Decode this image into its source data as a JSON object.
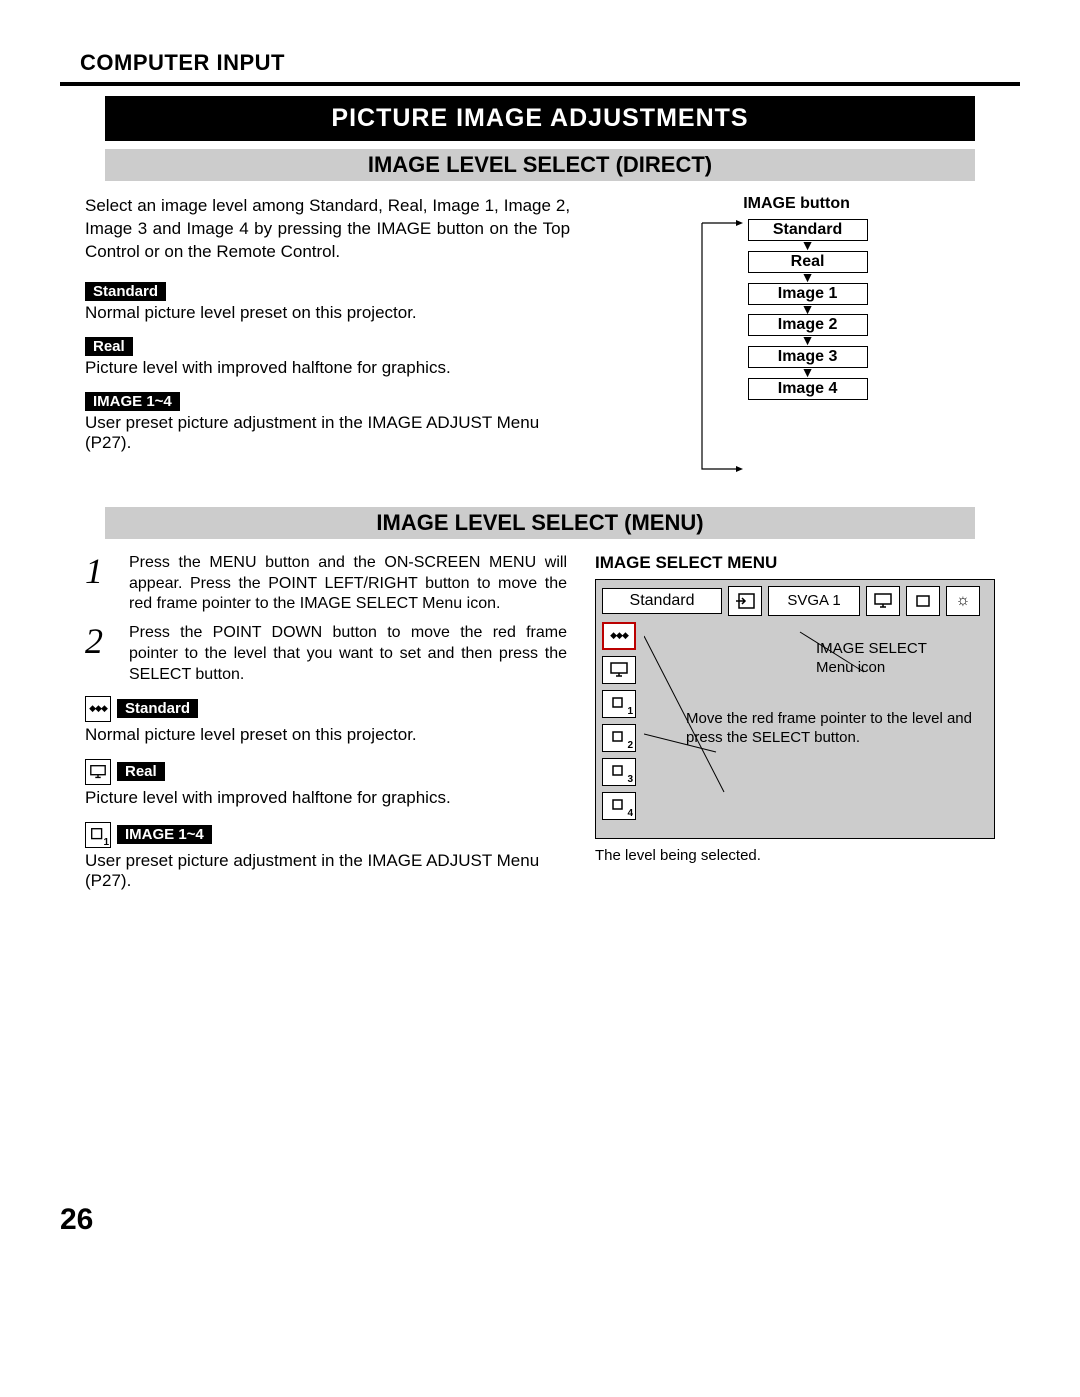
{
  "header": {
    "section_label": "COMPUTER INPUT"
  },
  "bars": {
    "main": "PICTURE IMAGE ADJUSTMENTS",
    "sub_direct": "IMAGE LEVEL SELECT (DIRECT)",
    "sub_menu": "IMAGE LEVEL SELECT (MENU)"
  },
  "direct": {
    "intro": "Select an image level among Standard, Real, Image 1, Image 2, Image 3 and Image 4 by pressing the IMAGE button on the Top Control or on the Remote Control.",
    "items": [
      {
        "label": "Standard",
        "desc": "Normal picture level preset on this projector."
      },
      {
        "label": "Real",
        "desc": "Picture level with improved halftone for graphics."
      },
      {
        "label": "IMAGE 1~4",
        "desc": "User preset picture adjustment in the IMAGE ADJUST Menu (P27)."
      }
    ],
    "flow": {
      "title": "IMAGE button",
      "boxes": [
        "Standard",
        "Real",
        "Image 1",
        "Image 2",
        "Image 3",
        "Image 4"
      ]
    }
  },
  "menu": {
    "steps": [
      {
        "num": "1",
        "text": "Press the MENU button and the ON-SCREEN MENU will appear.  Press the POINT LEFT/RIGHT button to move the red frame pointer to the IMAGE SELECT Menu icon."
      },
      {
        "num": "2",
        "text": "Press the POINT DOWN button to move the red frame pointer to the level that you want to set and then press the SELECT button."
      }
    ],
    "items": [
      {
        "label": "Standard",
        "desc": "Normal picture level preset on this projector.",
        "icon": "diamonds"
      },
      {
        "label": "Real",
        "desc": "Picture level with improved halftone for graphics.",
        "icon": "monitor"
      },
      {
        "label": "IMAGE 1~4",
        "desc": "User preset picture adjustment in the IMAGE ADJUST Menu (P27).",
        "icon": "img-num"
      }
    ],
    "panel": {
      "title": "IMAGE SELECT MENU",
      "top_label": "Standard",
      "svga": "SVGA 1",
      "callout_icon": "IMAGE SELECT\nMenu icon",
      "callout_pointer": "Move the red frame pointer to the level and press the SELECT button.",
      "caption": "The level being selected."
    }
  },
  "page_number": "26"
}
